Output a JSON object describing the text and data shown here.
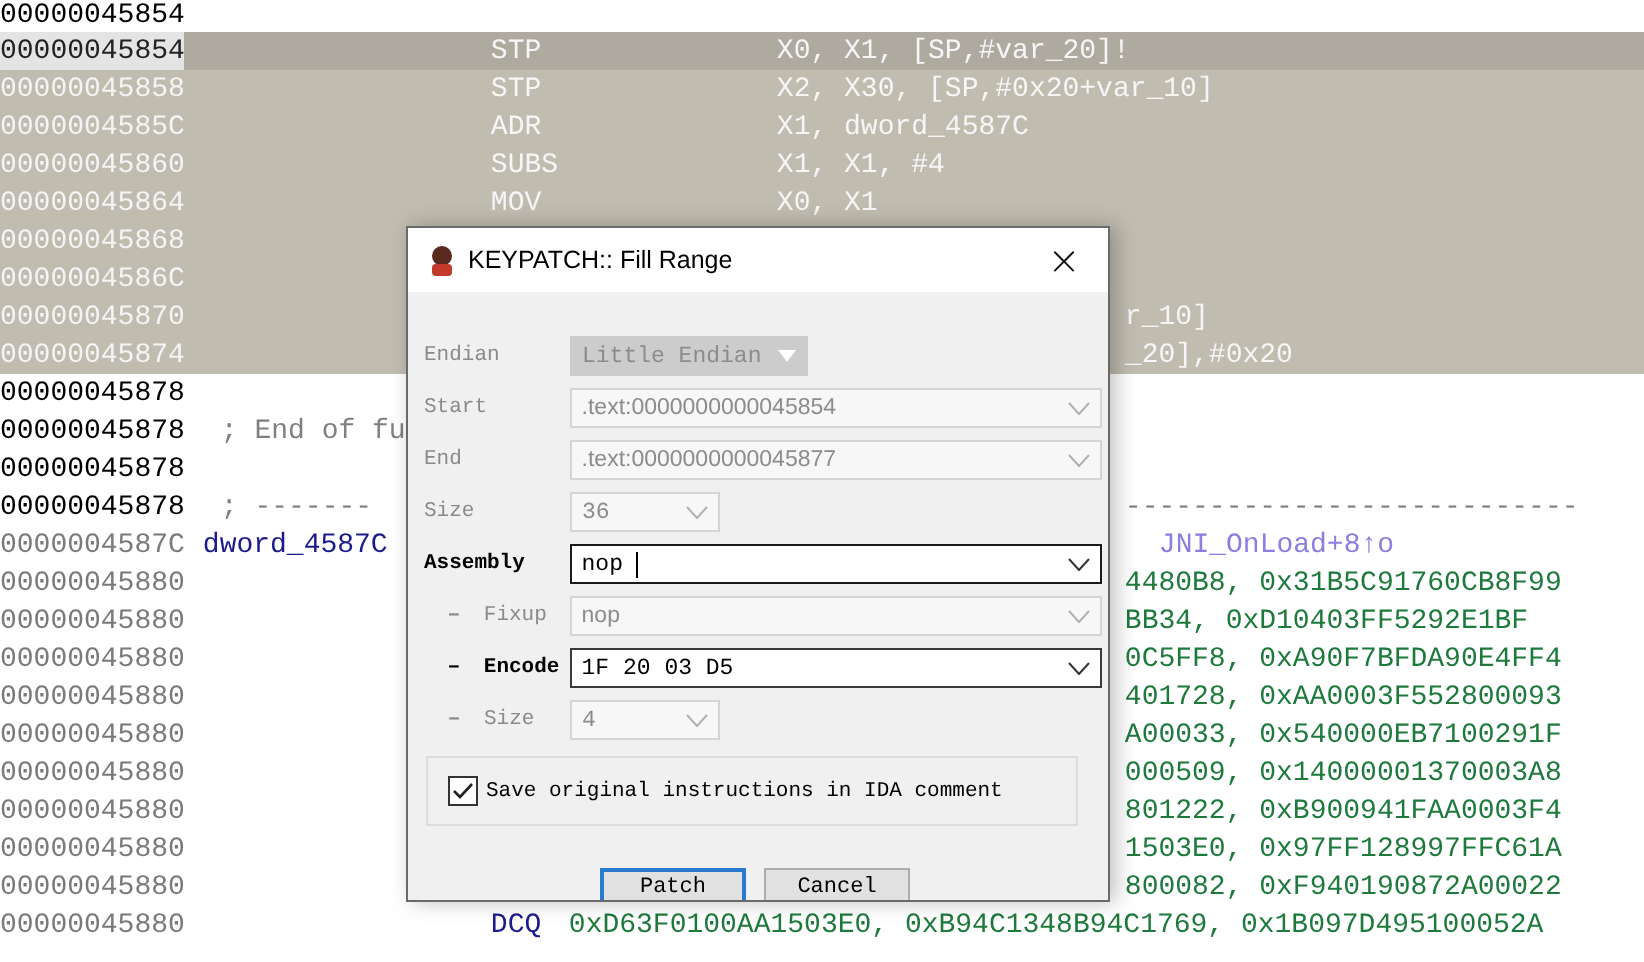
{
  "listing": {
    "rows": [
      {
        "kind": "code",
        "address": "00000045854",
        "selected": false,
        "current": false
      },
      {
        "kind": "code",
        "address": "00000045854",
        "selected": true,
        "current": true,
        "mnemonic": "STP",
        "operands": "X0, X1, [SP,#var_20]!"
      },
      {
        "kind": "code",
        "address": "00000045858",
        "selected": true,
        "current": false,
        "mnemonic": "STP",
        "operands": "X2, X30, [SP,#0x20+var_10]"
      },
      {
        "kind": "code",
        "address": "0000004585C",
        "selected": true,
        "current": false,
        "mnemonic": "ADR",
        "operands": "X1, dword_4587C"
      },
      {
        "kind": "code",
        "address": "00000045860",
        "selected": true,
        "current": false,
        "mnemonic": "SUBS",
        "operands": "X1, X1, #4"
      },
      {
        "kind": "code",
        "address": "00000045864",
        "selected": true,
        "current": false,
        "mnemonic": "MOV",
        "operands": "X0, X1"
      },
      {
        "kind": "code",
        "address": "00000045868",
        "selected": true,
        "current": false
      },
      {
        "kind": "code",
        "address": "0000004586C",
        "selected": true,
        "current": false
      },
      {
        "kind": "code",
        "address": "00000045870",
        "selected": true,
        "current": false,
        "tail": "r_10]"
      },
      {
        "kind": "code",
        "address": "00000045874",
        "selected": true,
        "current": false,
        "tail": "_20],#0x20"
      },
      {
        "kind": "code",
        "address": "00000045878",
        "selected": false,
        "current": false
      },
      {
        "kind": "code",
        "address": "00000045878",
        "selected": false,
        "current": false,
        "comment": "; End of fu"
      },
      {
        "kind": "code",
        "address": "00000045878",
        "selected": false,
        "current": false
      },
      {
        "kind": "code",
        "address": "00000045878",
        "selected": false,
        "current": false,
        "comment": "; -------",
        "tail": "---------------------------"
      },
      {
        "kind": "data",
        "address": "0000004587C",
        "selected": false,
        "current": false,
        "label": "dword_4587C",
        "xref": "JNI_OnLoad+8↑o"
      },
      {
        "kind": "data",
        "address": "00000045880",
        "selected": false,
        "current": false,
        "tail": "4480B8, 0x31B5C91760CB8F99"
      },
      {
        "kind": "data",
        "address": "00000045880",
        "selected": false,
        "current": false,
        "tail": "BB34, 0xD10403FF5292E1BF"
      },
      {
        "kind": "data",
        "address": "00000045880",
        "selected": false,
        "current": false,
        "tail": "0C5FF8, 0xA90F7BFDA90E4FF4"
      },
      {
        "kind": "data",
        "address": "00000045880",
        "selected": false,
        "current": false,
        "tail": "401728, 0xAA0003F552800093"
      },
      {
        "kind": "data",
        "address": "00000045880",
        "selected": false,
        "current": false,
        "tail": "A00033, 0x540000EB7100291F"
      },
      {
        "kind": "data",
        "address": "00000045880",
        "selected": false,
        "current": false,
        "tail": "000509, 0x14000001370003A8"
      },
      {
        "kind": "data",
        "address": "00000045880",
        "selected": false,
        "current": false,
        "tail": "801222, 0xB900941FAA0003F4"
      },
      {
        "kind": "data",
        "address": "00000045880",
        "selected": false,
        "current": false,
        "tail": "1503E0, 0x97FF128997FFC61A"
      },
      {
        "kind": "data",
        "address": "00000045880",
        "selected": false,
        "current": false,
        "tail": "800082, 0xF940190872A00022"
      },
      {
        "kind": "data",
        "address": "00000045880",
        "selected": false,
        "current": false,
        "mnemonic": "DCQ",
        "operands": "0xD63F0100AA1503E0, 0xB94C1348B94C1769, 0x1B097D495100052A"
      }
    ]
  },
  "dialog": {
    "title": "KEYPATCH:: Fill Range",
    "close": "×",
    "fields": [
      {
        "label": "Endian",
        "kind": "dropdown",
        "value": "Little Endian",
        "disabled": true
      },
      {
        "label": "Start",
        "kind": "combo",
        "value": ".text:0000000000045854",
        "disabled": true
      },
      {
        "label": "End",
        "kind": "combo",
        "value": ".text:0000000000045877",
        "disabled": true
      },
      {
        "label": "Size",
        "kind": "short",
        "value": "36",
        "disabled": true
      },
      {
        "label": "Assembly",
        "kind": "combo",
        "value": "nop",
        "disabled": false,
        "focused": true,
        "children": [
          {
            "bullet": "–",
            "label": "Fixup",
            "kind": "combo",
            "value": "nop",
            "disabled": true
          },
          {
            "bullet": "–",
            "label": "Encode",
            "kind": "combo",
            "value": "1F 20 03 D5",
            "disabled": false
          },
          {
            "bullet": "–",
            "label": "Size",
            "kind": "short",
            "value": "4",
            "disabled": true
          }
        ]
      }
    ],
    "checkbox": {
      "label": "Save original instructions in IDA comment",
      "checked": true
    },
    "buttons": [
      {
        "label": "Patch",
        "default": true
      },
      {
        "label": "Cancel",
        "default": false
      }
    ]
  }
}
